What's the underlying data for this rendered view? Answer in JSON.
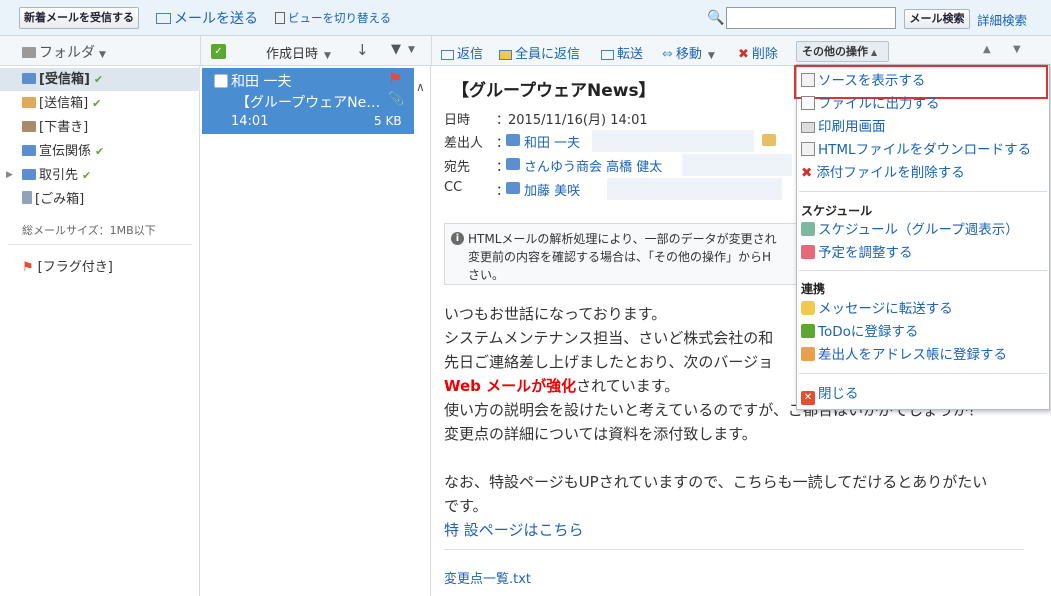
{
  "toolbar": {
    "receive_btn": "新着メールを受信する",
    "compose": "メールを送る",
    "view_toggle": "ビューを切り替える",
    "search_placeholder": "",
    "search_btn": "メール検索",
    "advanced_search": "詳細検索"
  },
  "folders": {
    "header": "フォルダ",
    "items": [
      {
        "label": "[受信箱]",
        "color": "#5b8fd0",
        "checked": true
      },
      {
        "label": "[送信箱]",
        "color": "#e0a95a",
        "checked": true
      },
      {
        "label": "[下書き]",
        "color": "#a98b6a",
        "checked": false
      },
      {
        "label": "宣伝関係",
        "color": "#5b8fd0",
        "checked": true
      },
      {
        "label": "取引先",
        "color": "#5b8fd0",
        "checked": true
      },
      {
        "label": "[ごみ箱]",
        "color": "#8fa4b8",
        "checked": false
      }
    ],
    "total_size": "総メールサイズ：1MB以下",
    "flagged": "[フラグ付き]"
  },
  "list": {
    "sort_label": "作成日時",
    "items": [
      {
        "sender": "和田 一夫",
        "subject": "【グループウェアNe…",
        "time": "14:01",
        "size": "5 KB"
      }
    ]
  },
  "actions": {
    "reply": "返信",
    "reply_all": "全員に返信",
    "forward": "転送",
    "move": "移動",
    "delete": "削除",
    "other": "その他の操作"
  },
  "message": {
    "title": "【グループウェアNews】",
    "date_label": "日時",
    "date_value": "2015/11/16(月) 14:01",
    "from_label": "差出人",
    "from_value": "和田 一夫",
    "to_label": "宛先",
    "to_value": "さんゆう商会 高橋 健太",
    "cc_label": "CC",
    "cc_value": "加藤 美咲",
    "notice_line1": "HTMLメールの解析処理により、一部のデータが変更され",
    "notice_line2": "変更前の内容を確認する場合は、「その他の操作」からH",
    "notice_line3": "さい。",
    "body": [
      "いつもお世話になっております。",
      "システムメンテナンス担当、さいど株式会社の和",
      "先日ご連絡差し上げましたとおり、次のバージョ",
      "",
      "使い方の説明会を設けたいと考えているのですが、ご都合はいかがでしょうか？",
      "変更点の詳細については資料を添付致します。",
      "",
      "なお、特設ページもUPされていますので、こちらも一読してだけるとありがたい",
      "です。"
    ],
    "body_red": "Web メールが強化",
    "body_red_tail": "されています。",
    "special_link": "特 設ページはこちら",
    "attachment": "変更点一覧.txt"
  },
  "menu": {
    "items_top": [
      "ソースを表示する",
      "ファイルに出力する",
      "印刷用画面",
      "HTMLファイルをダウンロードする",
      "添付ファイルを削除する"
    ],
    "schedule_header": "スケジュール",
    "schedule_items": [
      "スケジュール（グループ週表示）",
      "予定を調整する"
    ],
    "link_header": "連携",
    "link_items": [
      "メッセージに転送する",
      "ToDoに登録する",
      "差出人をアドレス帳に登録する"
    ],
    "close": "閉じる"
  }
}
